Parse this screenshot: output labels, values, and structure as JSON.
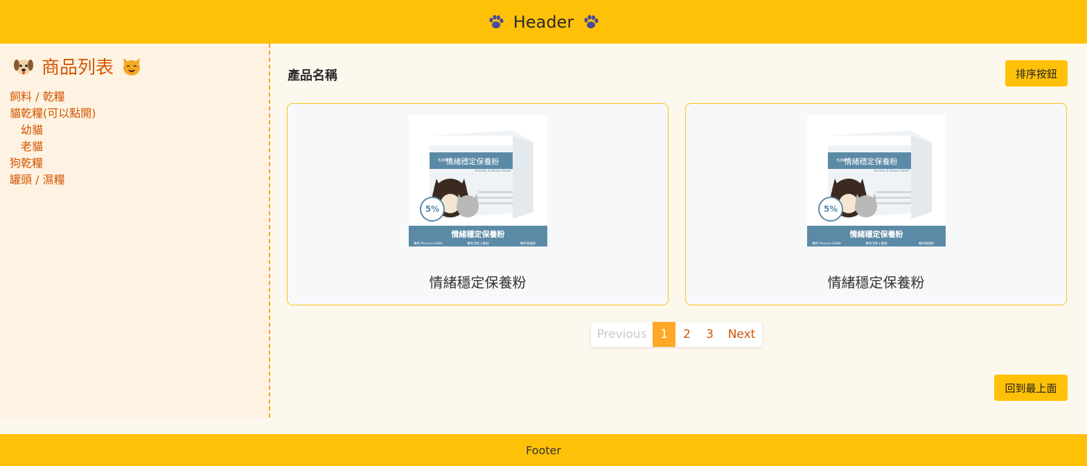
{
  "header": {
    "title": "Header",
    "left_icon": "paw-icon",
    "right_icon": "paw-icon"
  },
  "sidebar": {
    "title": "商品列表",
    "title_icons": [
      "dog-face-icon",
      "cat-face-icon"
    ],
    "items": [
      {
        "label": "飼料 / 乾糧"
      },
      {
        "label": "貓乾糧(可以點開)"
      },
      {
        "label": "幼貓"
      },
      {
        "label": "老貓"
      },
      {
        "label": "狗乾糧"
      },
      {
        "label": "罐頭 / 濕糧"
      }
    ]
  },
  "main": {
    "heading": "產品名稱",
    "sort_button": "排序按鈕",
    "products": [
      {
        "name": "情緒穩定保養粉",
        "image": {
          "box_title": "情緒穩定保養粉",
          "brand": "毛孩時代",
          "sub": "Anxiety & Stress Relief",
          "badge": "5%",
          "band_title": "情緒穩定保養粉",
          "tags": [
            "專利 Pharma GABA",
            "專利活性十胜肽",
            "專利海藻鈣"
          ]
        }
      },
      {
        "name": "情緒穩定保養粉",
        "image": {
          "box_title": "情緒穩定保養粉",
          "brand": "毛孩時代",
          "sub": "Anxiety & Stress Relief",
          "badge": "5%",
          "band_title": "情緒穩定保養粉",
          "tags": [
            "專利 Pharma GABA",
            "專利活性十胜肽",
            "專利海藻鈣"
          ]
        }
      }
    ],
    "pagination": {
      "previous": "Previous",
      "pages": [
        "1",
        "2",
        "3"
      ],
      "current": "1",
      "next": "Next"
    },
    "back_to_top": "回到最上面"
  },
  "footer": {
    "text": "Footer"
  },
  "colors": {
    "accent": "#ffc107",
    "link": "#d35400",
    "page_active": "#ffa726",
    "sidebar_bg": "#fef3e2",
    "card_border": "#f5c518"
  }
}
